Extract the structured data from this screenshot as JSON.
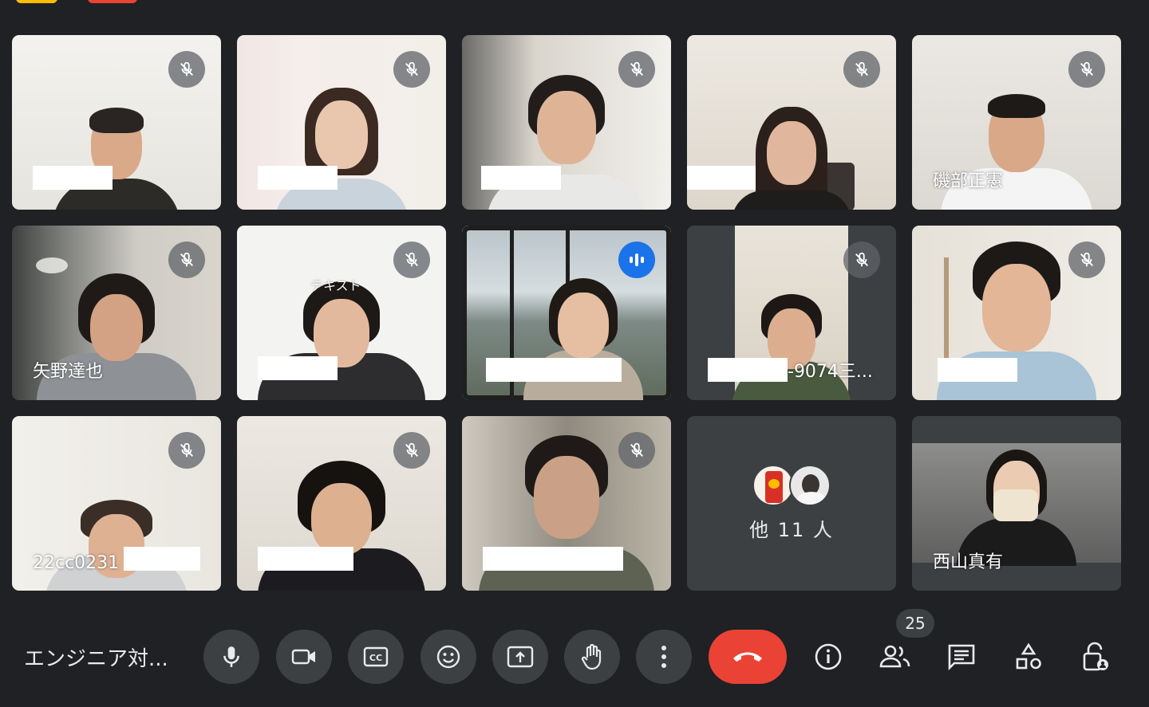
{
  "top_chips": [
    "yellow",
    "red"
  ],
  "tiles": [
    {
      "name": "",
      "muted": true
    },
    {
      "name": "",
      "muted": true
    },
    {
      "name": "",
      "muted": true
    },
    {
      "name": "",
      "muted": true
    },
    {
      "name": "磯部正憲",
      "muted": true
    },
    {
      "name": "矢野達也",
      "muted": true
    },
    {
      "name": "",
      "muted": true,
      "overlay_text": "テキスト"
    },
    {
      "name": "",
      "muted": false,
      "speaking": true
    },
    {
      "name": "-9074三...",
      "muted": true
    },
    {
      "name": "",
      "muted": true
    },
    {
      "name": "22cc0231",
      "muted": true
    },
    {
      "name": "",
      "muted": true
    },
    {
      "name": "",
      "muted": true
    },
    {
      "name": "西山真有",
      "muted": false
    }
  ],
  "others": {
    "label": "他 11 人"
  },
  "toolbar": {
    "meeting_title": "エンジニア対...",
    "participant_count": "25",
    "icons": [
      "mic-icon",
      "camera-icon",
      "captions-icon",
      "emoji-icon",
      "present-icon",
      "raise-hand-icon",
      "more-icon",
      "end-call-icon",
      "info-icon",
      "people-icon",
      "chat-icon",
      "activities-icon",
      "host-controls-icon"
    ]
  },
  "colors": {
    "background": "#202124",
    "tile": "#3c4043",
    "speaking": "#8ab4f8",
    "end_call": "#ea4335",
    "accent": "#1a73e8"
  }
}
